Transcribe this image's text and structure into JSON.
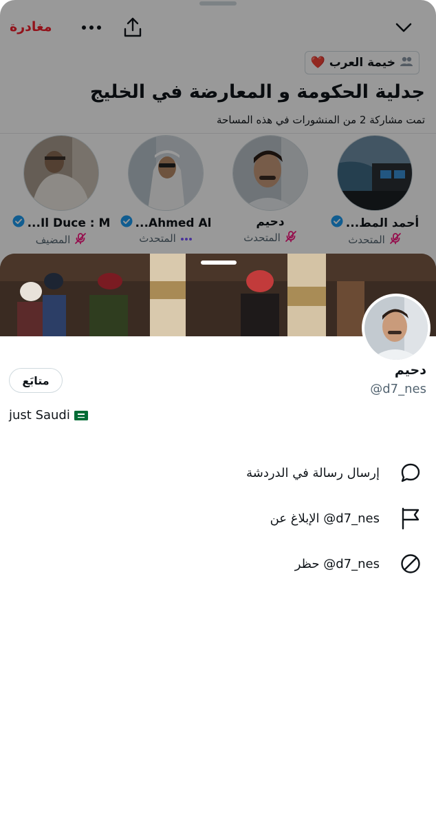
{
  "header": {
    "leave_label": "مغادرة",
    "more_icon": "more-horizontal-icon",
    "share_icon": "share-upload-icon",
    "collapse_icon": "chevron-down-icon"
  },
  "community": {
    "name": "خيمة العرب",
    "emoji": "❤️",
    "icon": "community-people-icon"
  },
  "space": {
    "title": "جدلية الحكومة و المعارضة في الخليج",
    "subtitle": "تمت مشاركة 2 من المنشورات في هذه المساحة"
  },
  "participants": [
    {
      "name": "أحمد المط...",
      "role": "المتحدث",
      "verified": true,
      "status_icon": "mic-muted-icon"
    },
    {
      "name": "دحيم",
      "role": "المتحدث",
      "verified": false,
      "status_icon": "mic-muted-icon"
    },
    {
      "name": "Ahmed Al...",
      "role": "المتحدث",
      "verified": true,
      "status_icon": "speaking-dots-icon"
    },
    {
      "name": "Il Duce : M...",
      "role": "المضيف",
      "verified": true,
      "status_icon": "mic-muted-icon"
    }
  ],
  "profile": {
    "name": "دحيم",
    "handle": "@d7_nes",
    "follow_label": "متابَع",
    "bio_text": "just Saudi",
    "bio_flag": "🇸🇦"
  },
  "actions": [
    {
      "label": "إرسال رسالة في الدردشة",
      "icon": "chat-bubble-icon"
    },
    {
      "label": "الإبلاغ عن @d7_nes",
      "icon": "flag-icon"
    },
    {
      "label": "حظر @d7_nes",
      "icon": "block-icon"
    }
  ],
  "colors": {
    "leave": "#f4212e",
    "verified": "#1d9bf0",
    "muted_mic": "#f91880",
    "text": "#0f1419",
    "secondary": "#536471"
  }
}
